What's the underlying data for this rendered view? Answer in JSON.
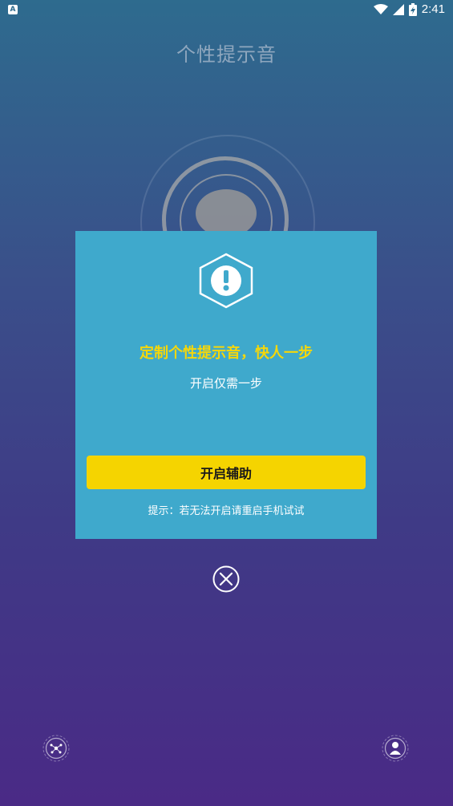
{
  "status_bar": {
    "app_icon_letter": "A",
    "time": "2:41"
  },
  "header": {
    "title": "个性提示音"
  },
  "dialog": {
    "title": "定制个性提示音，快人一步",
    "subtitle": "开启仅需一步",
    "enable_button_label": "开启辅助",
    "hint": "提示：若无法开启请重启手机试试"
  },
  "icons": {
    "warning": "warning-hexagon-icon",
    "close": "close-circle-icon",
    "bottom_left": "network-icon",
    "bottom_right": "profile-icon"
  }
}
